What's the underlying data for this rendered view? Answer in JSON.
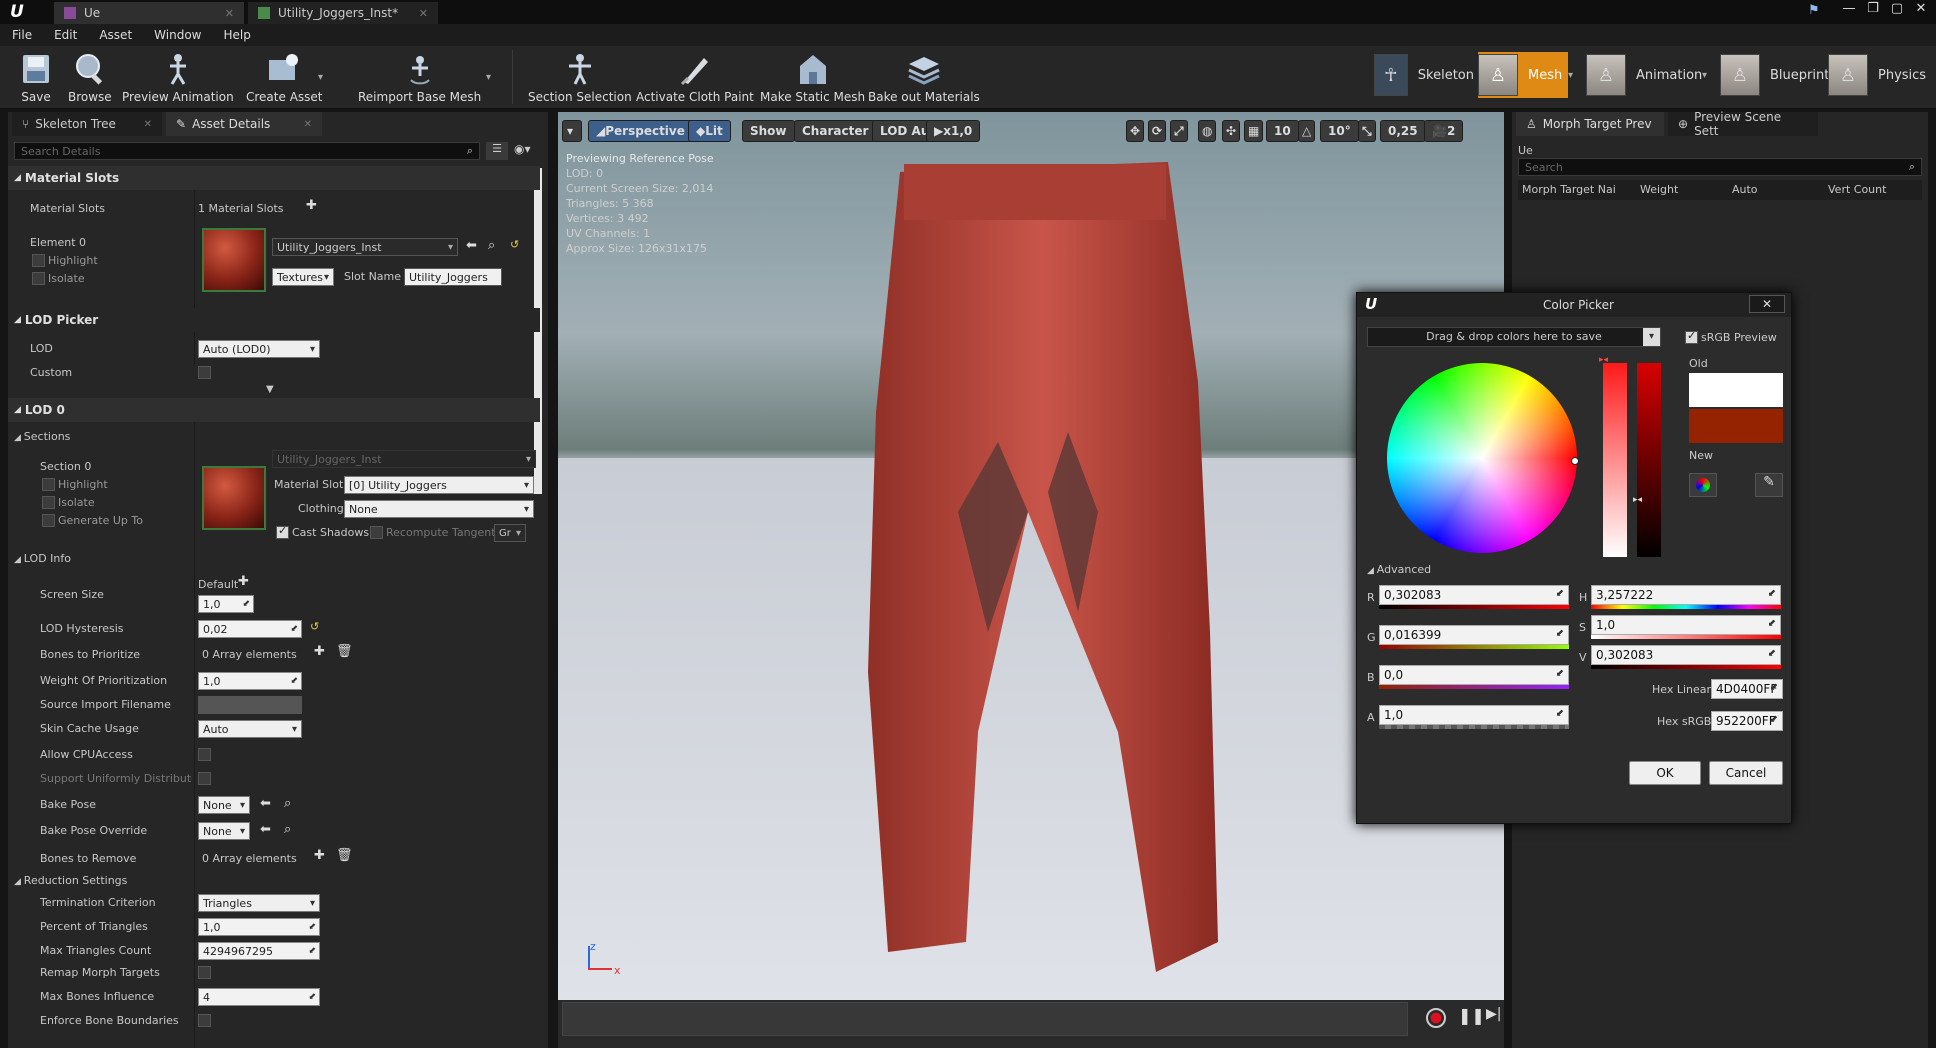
{
  "titlebar": {
    "tabs": [
      {
        "label": "Ue"
      },
      {
        "label": "Utility_Joggers_Inst*"
      }
    ],
    "logo": "unreal-logo",
    "window_buttons": [
      "minimize",
      "restore",
      "maximize",
      "close"
    ]
  },
  "menu": [
    "File",
    "Edit",
    "Asset",
    "Window",
    "Help"
  ],
  "toolbar": {
    "buttons": [
      {
        "label": "Save",
        "icon": "save-icon"
      },
      {
        "label": "Browse",
        "icon": "browse-icon"
      },
      {
        "label": "Preview Animation",
        "icon": "preview-animation-icon"
      },
      {
        "label": "Create Asset",
        "icon": "create-asset-icon"
      },
      {
        "label": "Reimport Base Mesh",
        "icon": "reimport-icon"
      },
      {
        "label": "Section Selection",
        "icon": "section-selection-icon"
      },
      {
        "label": "Activate Cloth Paint",
        "icon": "cloth-paint-icon"
      },
      {
        "label": "Make Static Mesh",
        "icon": "static-mesh-icon"
      },
      {
        "label": "Bake out Materials",
        "icon": "bake-materials-icon"
      }
    ],
    "modes": [
      "Skeleton",
      "Mesh",
      "Animation",
      "Blueprint",
      "Physics"
    ],
    "active_mode": "Mesh",
    "accent": "#e08a16"
  },
  "left": {
    "tabs": [
      "Skeleton Tree",
      "Asset Details"
    ],
    "search_placeholder": "Search Details",
    "material_slots": {
      "category": "Material Slots",
      "label": "Material Slots",
      "value": "1 Material Slots",
      "element": "Element 0",
      "highlight": "Highlight",
      "isolate": "Isolate",
      "material": "Utility_Joggers_Inst",
      "textures": "Textures",
      "slot_name_label": "Slot Name",
      "slot_name": "Utility_Joggers"
    },
    "lod_picker": {
      "category": "LOD Picker",
      "lod_label": "LOD",
      "lod_value": "Auto (LOD0)",
      "custom_label": "Custom"
    },
    "lod0": {
      "category": "LOD 0",
      "sections": "Sections",
      "section0": "Section 0",
      "highlight": "Highlight",
      "isolate": "Isolate",
      "generate": "Generate Up To",
      "material_dim": "Utility_Joggers_Inst",
      "material_slot_label": "Material Slot",
      "material_slot": "[0] Utility_Joggers",
      "clothing_label": "Clothing",
      "clothing": "None",
      "cast_shadows": "Cast Shadows",
      "recompute": "Recompute Tangent",
      "gr": "Gr"
    },
    "lod_info": {
      "title": "LOD Info",
      "default": "Default",
      "screen_size_label": "Screen Size",
      "screen_size": "1,0",
      "hysteresis_label": "LOD Hysteresis",
      "hysteresis": "0,02",
      "bones_prio_label": "Bones to Prioritize",
      "bones_prio": "0 Array elements",
      "weight_label": "Weight Of Prioritization",
      "weight": "1,0",
      "source_label": "Source Import Filename",
      "skin_cache_label": "Skin Cache Usage",
      "skin_cache": "Auto",
      "allow_cpu_label": "Allow CPUAccess",
      "support_label": "Support Uniformly Distributed",
      "bake_pose_label": "Bake Pose",
      "bake_pose": "None",
      "bake_override_label": "Bake Pose Override",
      "bake_override": "None",
      "bones_remove_label": "Bones to Remove",
      "bones_remove": "0 Array elements"
    },
    "reduction": {
      "title": "Reduction Settings",
      "term_label": "Termination Criterion",
      "term": "Triangles",
      "pct_label": "Percent of Triangles",
      "pct": "1,0",
      "max_tri_label": "Max Triangles Count",
      "max_tri": "4294967295",
      "remap_label": "Remap Morph Targets",
      "max_bones_label": "Max Bones Influence",
      "max_bones": "4",
      "enforce_label": "Enforce Bone Boundaries"
    }
  },
  "viewport": {
    "perspective": "Perspective",
    "lit": "Lit",
    "show": "Show",
    "character": "Character",
    "lod": "LOD Auto",
    "speed": "x1,0",
    "grid": "10",
    "angle": "10°",
    "scale": "0,25",
    "cam": "2",
    "info": [
      "Previewing Reference Pose",
      "LOD: 0",
      "Current Screen Size: 2,014",
      "Triangles: 5 368",
      "Vertices: 3 492",
      "UV Channels: 1",
      "Approx Size: 126x31x175"
    ],
    "axis_z": "z",
    "axis_x": "x"
  },
  "right": {
    "tabs": [
      "Morph Target Prev",
      "Preview Scene Sett"
    ],
    "asset": "Ue",
    "search_placeholder": "Search",
    "columns": [
      "Morph Target Nai",
      "Weight",
      "Auto",
      "Vert Count"
    ]
  },
  "color_picker": {
    "title": "Color Picker",
    "dropzone": "Drag & drop colors here to save",
    "srgb_preview": "sRGB Preview",
    "old": "Old",
    "new": "New",
    "advanced": "Advanced",
    "r_label": "R",
    "r": "0,302083",
    "g_label": "G",
    "g": "0,016399",
    "b_label": "B",
    "b": "0,0",
    "a_label": "A",
    "a": "1,0",
    "h_label": "H",
    "h": "3,257222",
    "s_label": "S",
    "s": "1,0",
    "v_label": "V",
    "v": "0,302083",
    "hex_linear_label": "Hex Linear",
    "hex_linear": "4D0400FF",
    "hex_srgb_label": "Hex sRGB",
    "hex_srgb": "952200FF",
    "ok": "OK",
    "cancel": "Cancel",
    "new_color": "#952200",
    "old_color": "#ffffff"
  }
}
